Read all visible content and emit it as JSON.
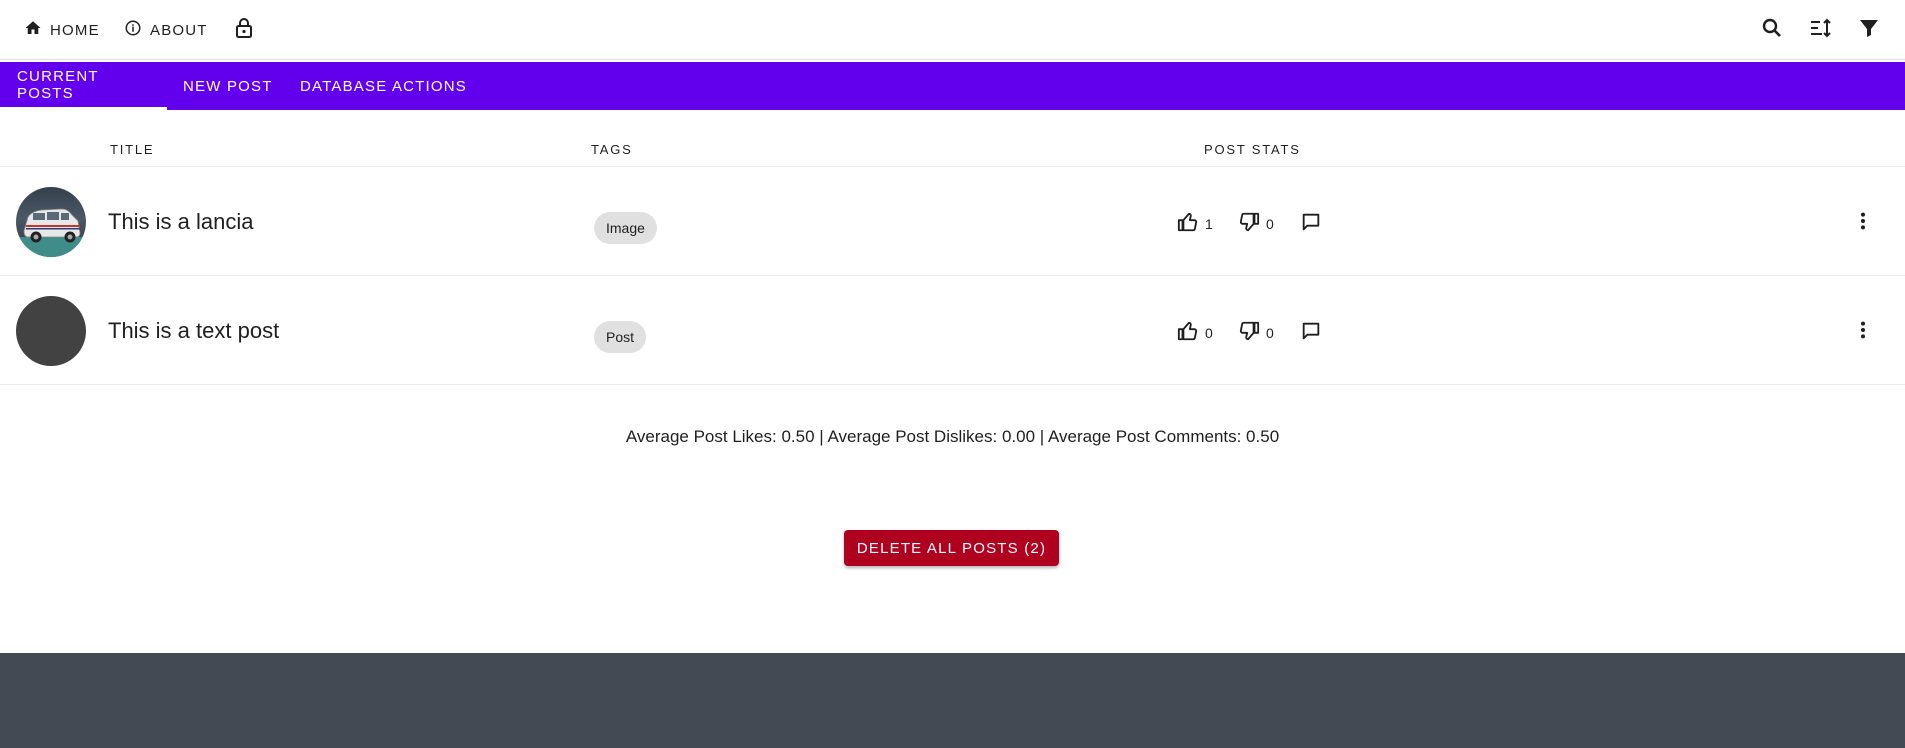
{
  "topbar": {
    "home_label": "Home",
    "about_label": "About",
    "icons": [
      "home-icon",
      "info-icon",
      "lock-icon",
      "search-icon",
      "sort-icon",
      "filter-icon"
    ]
  },
  "tabs": [
    {
      "label": "Current Posts",
      "active": true
    },
    {
      "label": "New Post",
      "active": false
    },
    {
      "label": "Database Actions",
      "active": false
    }
  ],
  "table": {
    "headers": {
      "title": "Title",
      "tags": "Tags",
      "stats": "Post Stats"
    },
    "rows": [
      {
        "title": "This is a lancia",
        "tag": "Image",
        "likes": "1",
        "dislikes": "0",
        "has_image": true
      },
      {
        "title": "This is a text post",
        "tag": "Post",
        "likes": "0",
        "dislikes": "0",
        "has_image": false
      }
    ]
  },
  "summary": "Average Post Likes: 0.50 | Average Post Dislikes: 0.00 | Average Post Comments: 0.50",
  "delete_button": "Delete All Posts (2)",
  "colors": {
    "accent": "#6200ee",
    "danger": "#b00020",
    "footer": "#434a53",
    "chip": "#e0e0e0"
  }
}
